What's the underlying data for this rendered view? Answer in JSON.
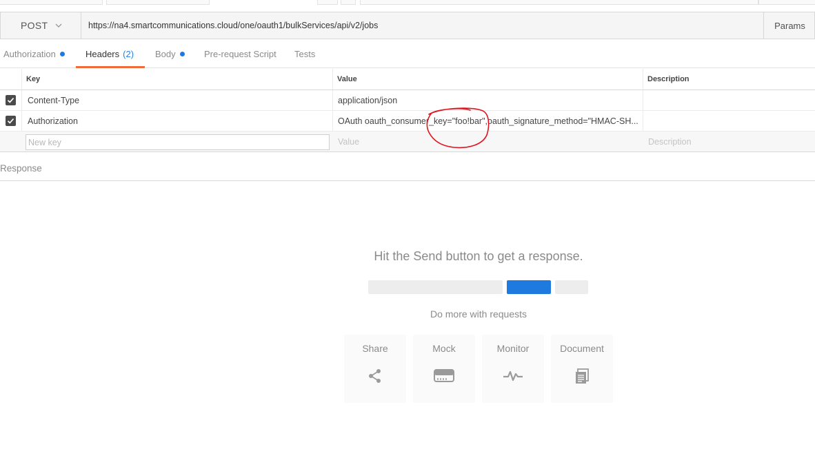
{
  "request": {
    "method": "POST",
    "url": "https://na4.smartcommunications.cloud/one/oauth1/bulkServices/api/v2/jobs",
    "params_label": "Params"
  },
  "subtabs": [
    {
      "label": "Authorization",
      "dot": true
    },
    {
      "label": "Headers",
      "count": "(2)",
      "active": true
    },
    {
      "label": "Body",
      "dot": true
    },
    {
      "label": "Pre-request Script"
    },
    {
      "label": "Tests"
    }
  ],
  "headers_table": {
    "columns": {
      "key": "Key",
      "value": "Value",
      "description": "Description"
    },
    "rows": [
      {
        "checked": true,
        "key": "Content-Type",
        "value": "application/json",
        "description": ""
      },
      {
        "checked": true,
        "key": "Authorization",
        "value": "OAuth oauth_consumer_key=\"foo!bar\",oauth_signature_method=\"HMAC-SH...",
        "description": ""
      }
    ],
    "new_row": {
      "key_placeholder": "New key",
      "value_placeholder": "Value",
      "description_placeholder": "Description"
    }
  },
  "response": {
    "label": "Response",
    "empty_title": "Hit the Send button to get a response.",
    "do_more": "Do more with requests",
    "cards": [
      {
        "label": "Share",
        "icon": "share-icon"
      },
      {
        "label": "Mock",
        "icon": "mock-server-icon"
      },
      {
        "label": "Monitor",
        "icon": "monitor-pulse-icon"
      },
      {
        "label": "Document",
        "icon": "document-icon"
      }
    ]
  },
  "colors": {
    "accent_blue": "#1f7ae0",
    "active_tab_underline": "#f26b3a",
    "annotation_red": "#e0141e"
  }
}
